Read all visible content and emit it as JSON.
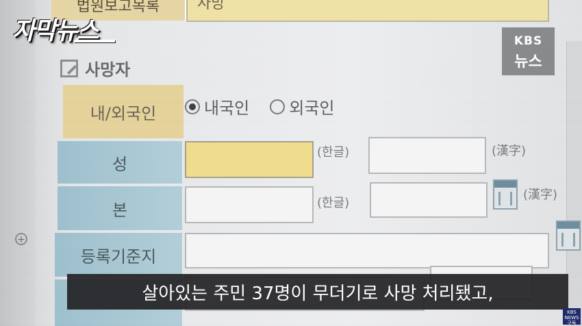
{
  "overlay": {
    "program_logo": "자막뉴스",
    "broadcaster": {
      "line1": "KBS",
      "line2": "뉴스"
    },
    "subtitle": "살아있는 주민 37명이 무더기로 사망 처리됐고,",
    "mini_badge": {
      "line1": "KBS",
      "line2": "NEWS",
      "line3": "구독"
    }
  },
  "form": {
    "top_row": {
      "label": "법원보고목록",
      "value": "사망"
    },
    "section_title": "사망자",
    "nationality": {
      "label": "내/외국인",
      "options": [
        {
          "label": "내국인",
          "selected": true
        },
        {
          "label": "외국인",
          "selected": false
        }
      ]
    },
    "fields": {
      "surname": {
        "label": "성",
        "korean_tag": "(한글)",
        "hanja_tag": "(漢字)"
      },
      "clan": {
        "label": "본",
        "korean_tag": "(한글)",
        "hanja_tag": "(漢字)"
      },
      "registration": {
        "label": "등록기준지"
      }
    }
  },
  "colors": {
    "label_yellow": "#e6d49c",
    "label_blue": "#a9c8d4",
    "field_yellow": "#f1de8e",
    "subtitle_bg": "#232326"
  }
}
